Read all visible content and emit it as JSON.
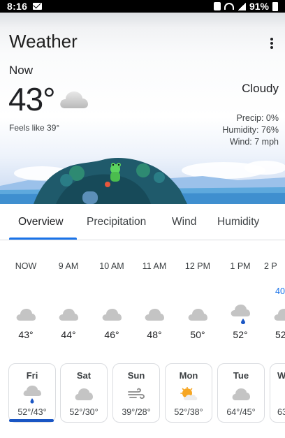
{
  "status_bar": {
    "time": "8:16",
    "battery": "91%"
  },
  "header": {
    "title": "Weather"
  },
  "current": {
    "label": "Now",
    "temp": "43°",
    "feels_like": "Feels like 39°",
    "condition": "Cloudy",
    "precip": "Precip: 0%",
    "humidity": "Humidity: 76%",
    "wind": "Wind: 7 mph"
  },
  "tabs": [
    {
      "label": "Overview",
      "active": true
    },
    {
      "label": "Precipitation",
      "active": false
    },
    {
      "label": "Wind",
      "active": false
    },
    {
      "label": "Humidity",
      "active": false
    }
  ],
  "hourly": [
    {
      "time": "NOW",
      "temp": "43°",
      "icon": "cloud-icon"
    },
    {
      "time": "9 AM",
      "temp": "44°",
      "icon": "cloud-icon"
    },
    {
      "time": "10 AM",
      "temp": "46°",
      "icon": "cloud-icon"
    },
    {
      "time": "11 AM",
      "temp": "48°",
      "icon": "cloud-icon"
    },
    {
      "time": "12 PM",
      "temp": "50°",
      "icon": "cloud-icon"
    },
    {
      "time": "1 PM",
      "temp": "52°",
      "icon": "rain-cloud-icon"
    },
    {
      "time": "2 P",
      "temp": "52",
      "icon": "cloud-icon",
      "precip": "40"
    }
  ],
  "daily": [
    {
      "day": "Fri",
      "range": "52°/43°",
      "icon": "rain-cloud-icon",
      "selected": true
    },
    {
      "day": "Sat",
      "range": "52°/30°",
      "icon": "cloud-icon",
      "selected": false
    },
    {
      "day": "Sun",
      "range": "39°/28°",
      "icon": "wind-icon",
      "selected": false
    },
    {
      "day": "Mon",
      "range": "52°/38°",
      "icon": "partly-sunny-icon",
      "selected": false
    },
    {
      "day": "Tue",
      "range": "64°/45°",
      "icon": "cloud-icon",
      "selected": false
    },
    {
      "day": "W",
      "range": "63",
      "icon": "cloud-icon",
      "selected": false
    }
  ],
  "colors": {
    "accent": "#1a73e8",
    "tab_indicator": "#1a73e8",
    "rain_drop": "#1a56c4"
  }
}
